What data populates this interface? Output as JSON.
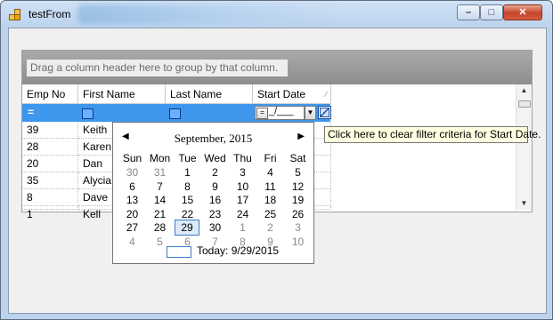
{
  "window": {
    "title": "testFrom",
    "controls": {
      "minimize": "–",
      "maximize": "□",
      "close": "✕"
    }
  },
  "grid": {
    "group_hint": "Drag a column header here to group by that column.",
    "columns": [
      "Emp No",
      "First Name",
      "Last Name",
      "Start Date"
    ],
    "filter_row": {
      "emp_no": "=",
      "start_date_mask": "_/___"
    },
    "rows": [
      {
        "emp_no": "39",
        "first_name": "Keith"
      },
      {
        "emp_no": "28",
        "first_name": "Karen"
      },
      {
        "emp_no": "20",
        "first_name": "Dan"
      },
      {
        "emp_no": "35",
        "first_name": "Alycia"
      },
      {
        "emp_no": "8",
        "first_name": "Dave"
      },
      {
        "emp_no": "1",
        "first_name": "Kell"
      }
    ]
  },
  "tooltip": "Click here to clear filter criteria for Start Date.",
  "calendar": {
    "title": "September, 2015",
    "prev_icon": "◀",
    "next_icon": "▶",
    "days_of_week": [
      "Sun",
      "Mon",
      "Tue",
      "Wed",
      "Thu",
      "Fri",
      "Sat"
    ],
    "weeks": [
      [
        "30",
        "31",
        "1",
        "2",
        "3",
        "4",
        "5"
      ],
      [
        "6",
        "7",
        "8",
        "9",
        "10",
        "11",
        "12"
      ],
      [
        "13",
        "14",
        "15",
        "16",
        "17",
        "18",
        "19"
      ],
      [
        "20",
        "21",
        "22",
        "23",
        "24",
        "25",
        "26"
      ],
      [
        "27",
        "28",
        "29",
        "30",
        "1",
        "2",
        "3"
      ],
      [
        "4",
        "5",
        "6",
        "7",
        "8",
        "9",
        "10"
      ]
    ],
    "selected_day": "29",
    "today_label": "Today: 9/29/2015"
  }
}
